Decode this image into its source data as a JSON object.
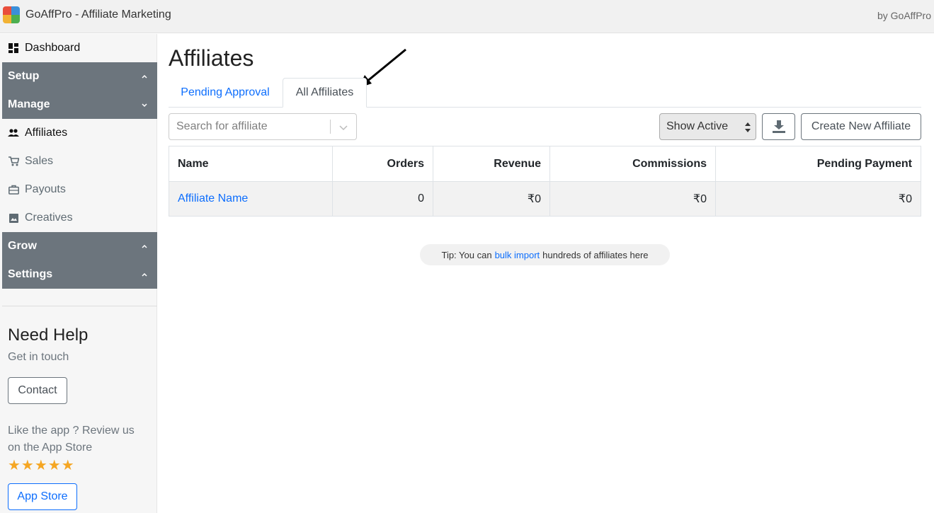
{
  "app": {
    "title": "GoAffPro - Affiliate Marketing",
    "by": "by GoAffPro",
    "logo_icon": "puzzle-logo-icon"
  },
  "sidebar": {
    "dashboard": {
      "label": "Dashboard",
      "icon": "dashboard-icon"
    },
    "sections": {
      "setup": {
        "label": "Setup",
        "icon": "chevron-up-icon"
      },
      "manage": {
        "label": "Manage",
        "icon": "chevron-down-icon"
      },
      "grow": {
        "label": "Grow",
        "icon": "chevron-up-icon"
      },
      "settings": {
        "label": "Settings",
        "icon": "chevron-up-icon"
      }
    },
    "manage_items": [
      {
        "label": "Affiliates",
        "icon": "people-icon",
        "active": true
      },
      {
        "label": "Sales",
        "icon": "cart-icon"
      },
      {
        "label": "Payouts",
        "icon": "briefcase-icon"
      },
      {
        "label": "Creatives",
        "icon": "image-icon"
      }
    ],
    "help": {
      "title": "Need Help",
      "subtitle": "Get in touch",
      "contact_label": "Contact",
      "review_text": "Like the app ? Review us on the App Store",
      "stars": "★★★★★",
      "rating": 5,
      "app_store_label": "App Store"
    }
  },
  "main": {
    "title": "Affiliates",
    "tabs": [
      {
        "label": "Pending Approval",
        "active": false
      },
      {
        "label": "All Affiliates",
        "active": true
      }
    ],
    "search": {
      "placeholder": "Search for affiliate"
    },
    "filter": {
      "selected": "Show Active"
    },
    "download_icon": "download-icon",
    "create_label": "Create New Affiliate",
    "table": {
      "columns": [
        "Name",
        "Orders",
        "Revenue",
        "Commissions",
        "Pending Payment"
      ],
      "rows": [
        {
          "name": "Affiliate Name",
          "orders": "0",
          "revenue": "₹0",
          "commissions": "₹0",
          "pending": "₹0"
        }
      ]
    },
    "tip": {
      "prefix": "Tip: You can",
      "link": "bulk import",
      "suffix": "hundreds of affiliates here"
    }
  },
  "colors": {
    "accent": "#0d6efd",
    "section_bg": "#6c757d",
    "star": "#f5a623"
  }
}
